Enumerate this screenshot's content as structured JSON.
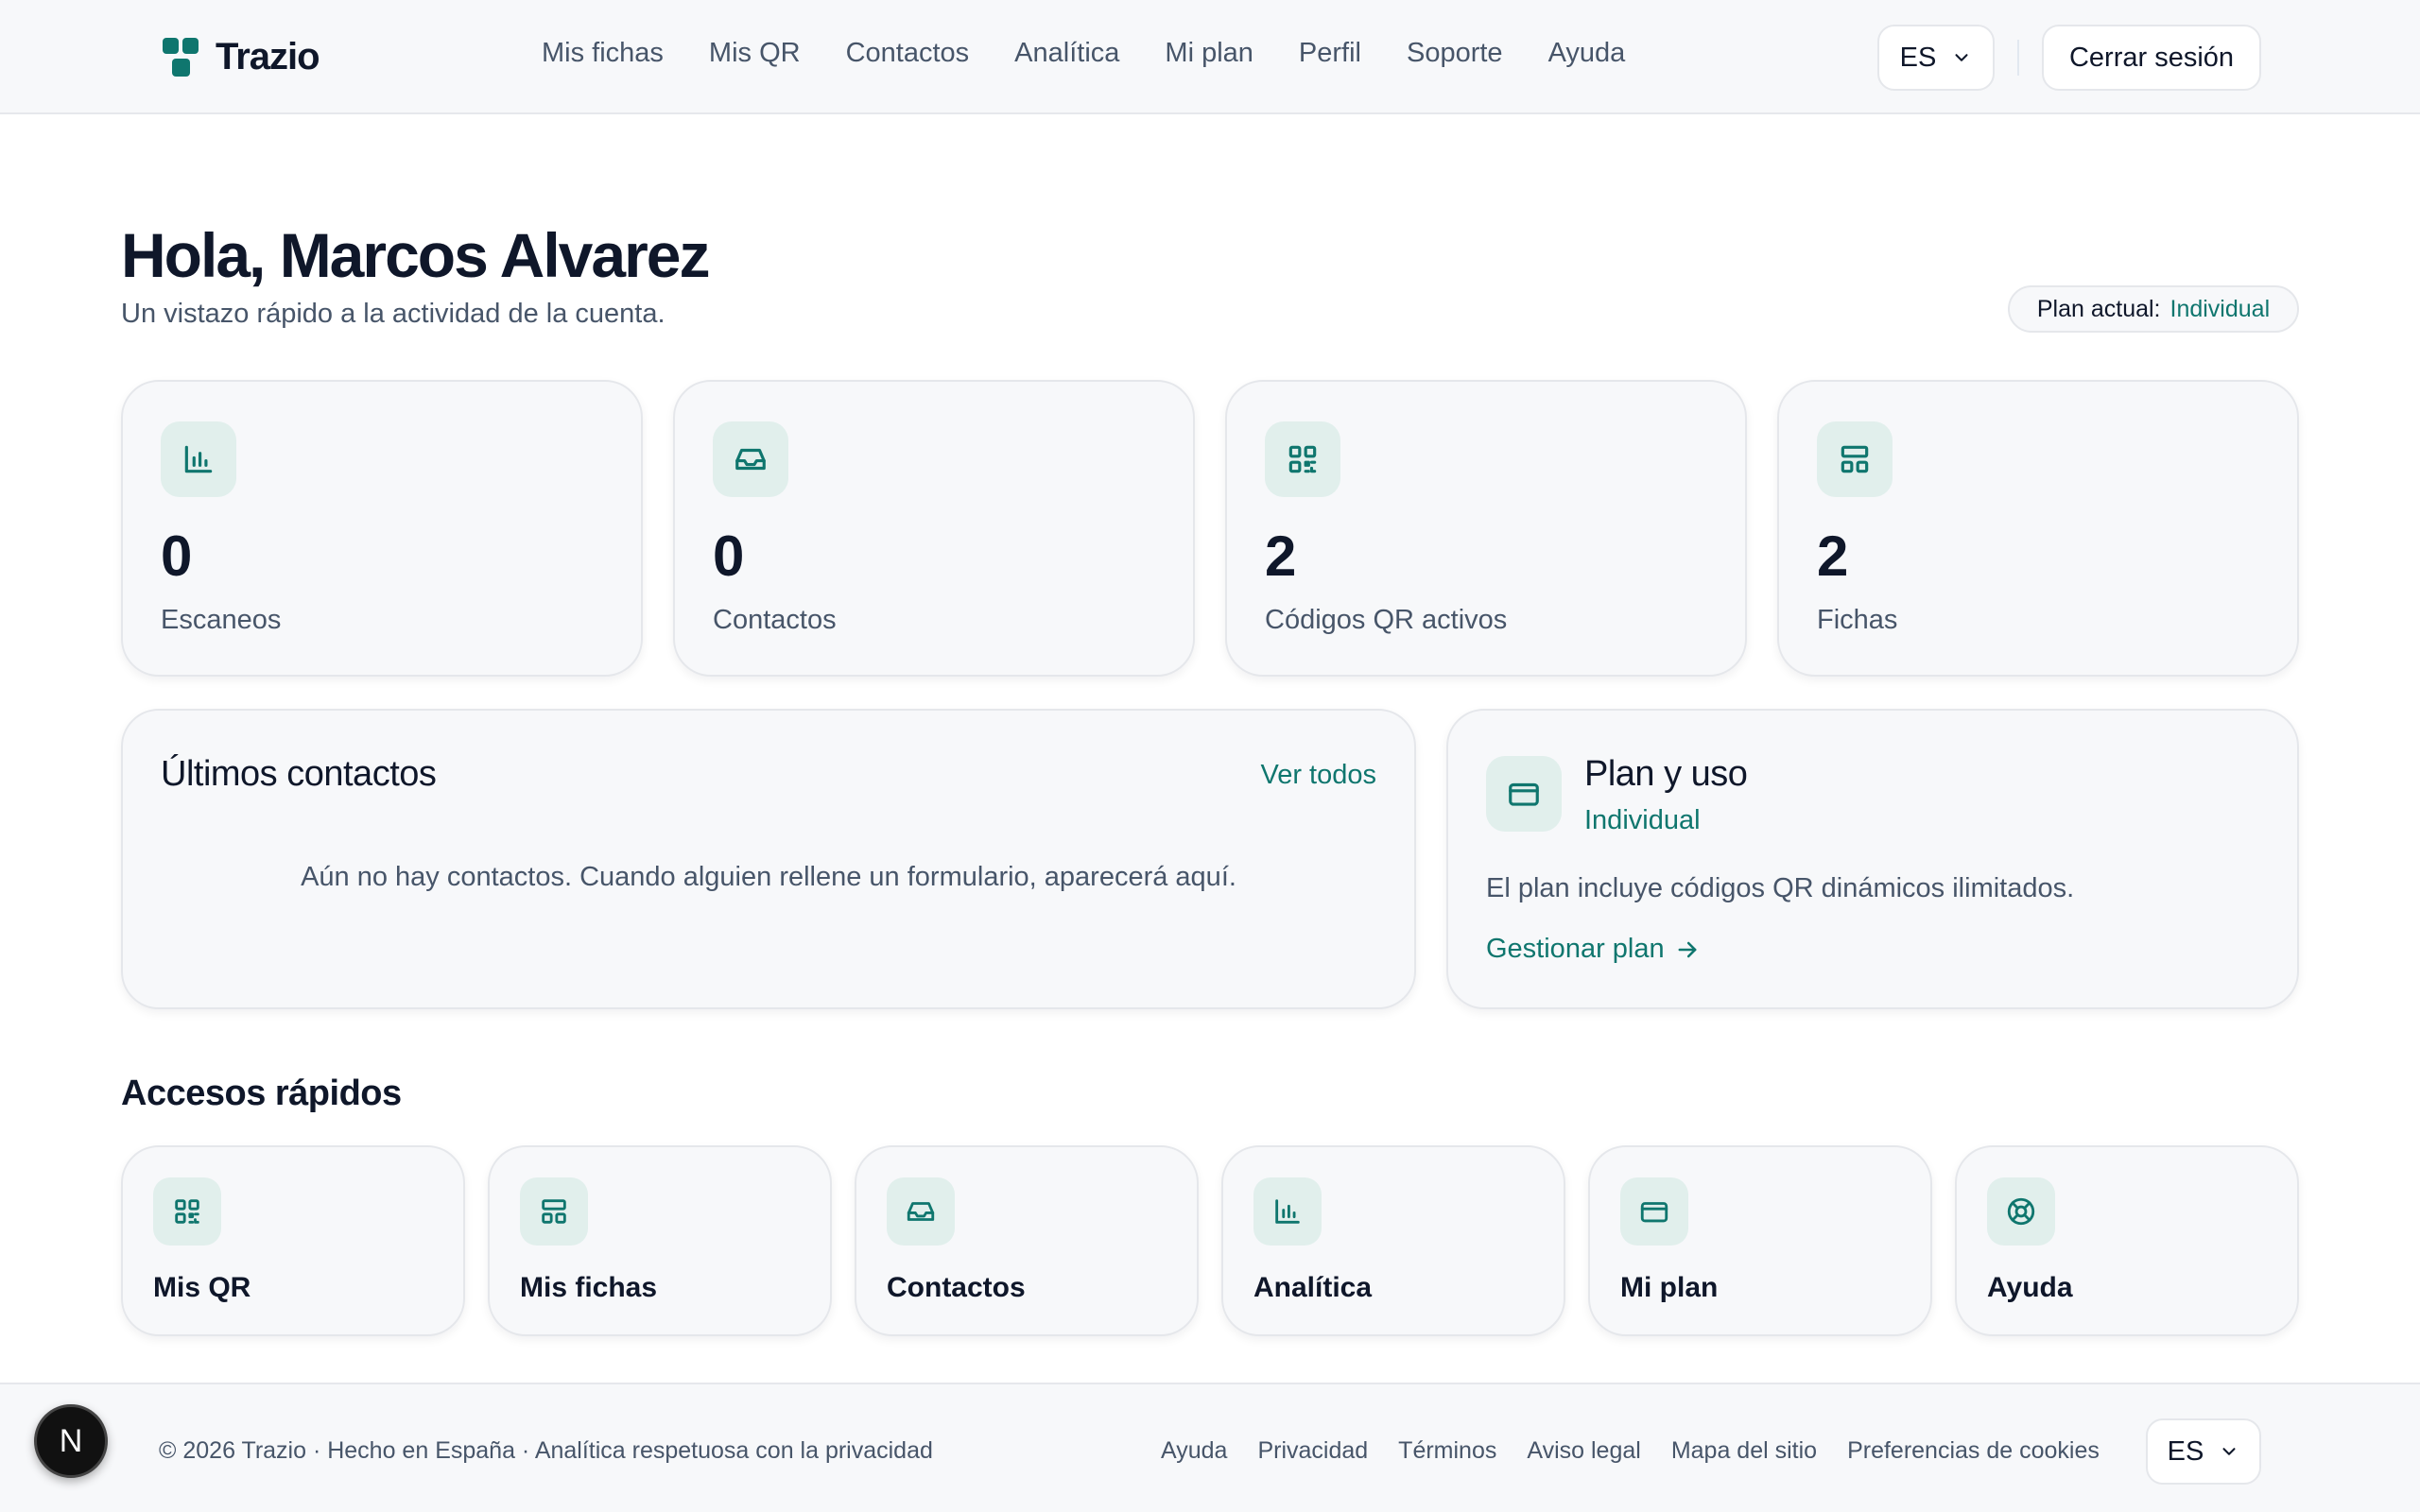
{
  "header": {
    "brand": "Trazio",
    "nav": [
      "Mis fichas",
      "Mis QR",
      "Contactos",
      "Analítica",
      "Mi plan",
      "Perfil",
      "Soporte",
      "Ayuda"
    ],
    "language": "ES",
    "logout_label": "Cerrar sesión"
  },
  "greeting": {
    "title": "Hola, Marcos Alvarez",
    "subtitle": "Un vistazo rápido a la actividad de la cuenta."
  },
  "plan_badge": {
    "label": "Plan actual:",
    "value": "Individual"
  },
  "stats": [
    {
      "value": "0",
      "label": "Escaneos",
      "icon": "bar-chart-icon"
    },
    {
      "value": "0",
      "label": "Contactos",
      "icon": "inbox-icon"
    },
    {
      "value": "2",
      "label": "Códigos QR activos",
      "icon": "qr-code-icon"
    },
    {
      "value": "2",
      "label": "Fichas",
      "icon": "layout-icon"
    }
  ],
  "recent_contacts": {
    "title": "Últimos contactos",
    "view_all": "Ver todos",
    "empty": "Aún no hay contactos. Cuando alguien rellene un formulario, aparecerá aquí."
  },
  "plan_usage": {
    "title": "Plan y uso",
    "plan_name": "Individual",
    "description": "El plan incluye códigos QR dinámicos ilimitados.",
    "manage_label": "Gestionar plan"
  },
  "quick_access": {
    "title": "Accesos rápidos",
    "items": [
      {
        "label": "Mis QR",
        "icon": "qr-code-icon"
      },
      {
        "label": "Mis fichas",
        "icon": "layout-icon"
      },
      {
        "label": "Contactos",
        "icon": "inbox-icon"
      },
      {
        "label": "Analítica",
        "icon": "bar-chart-icon"
      },
      {
        "label": "Mi plan",
        "icon": "credit-card-icon"
      },
      {
        "label": "Ayuda",
        "icon": "life-buoy-icon"
      }
    ]
  },
  "footer": {
    "copyright": "© 2026 Trazio · Hecho en España · Analítica respetuosa con la privacidad",
    "links": [
      "Ayuda",
      "Privacidad",
      "Términos",
      "Aviso legal",
      "Mapa del sitio",
      "Preferencias de cookies"
    ],
    "language": "ES"
  },
  "dev_badge": "N",
  "colors": {
    "accent": "#0f766e",
    "icon_bg": "#e1efec",
    "card_bg": "#f7f8fa"
  }
}
